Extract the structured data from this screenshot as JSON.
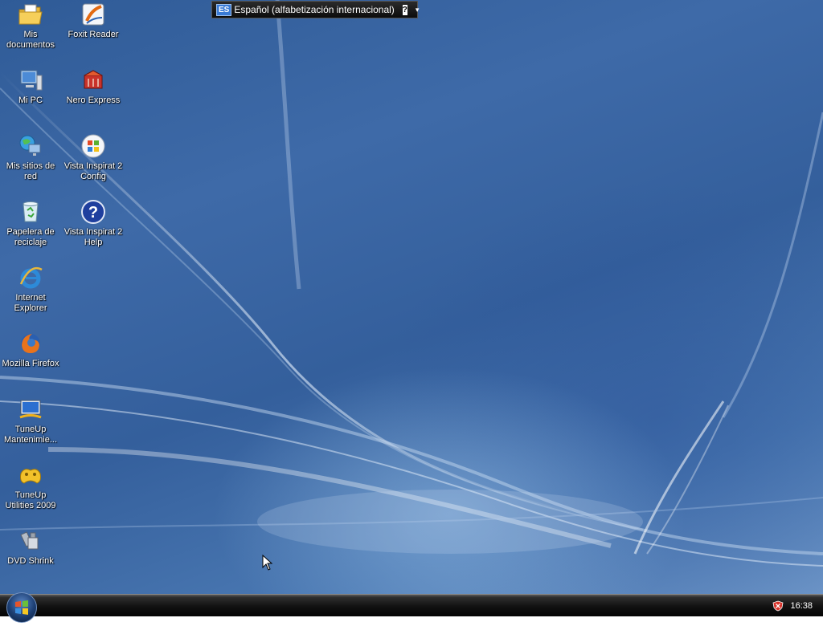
{
  "language_bar": {
    "code": "ES",
    "name": "Español (alfabetización internacional)",
    "help": "?",
    "options": "▾"
  },
  "desktop_icons": [
    {
      "id": "my-documents",
      "label": "Mis documentos",
      "icon": "folder-documents-icon"
    },
    {
      "id": "my-computer",
      "label": "Mi PC",
      "icon": "computer-icon"
    },
    {
      "id": "network-places",
      "label": "Mis sitios de red",
      "icon": "network-globe-icon"
    },
    {
      "id": "recycle-bin",
      "label": "Papelera de reciclaje",
      "icon": "recycle-bin-icon"
    },
    {
      "id": "internet-explorer",
      "label": "Internet Explorer",
      "icon": "internet-explorer-icon"
    },
    {
      "id": "mozilla-firefox",
      "label": "Mozilla Firefox",
      "icon": "firefox-icon"
    },
    {
      "id": "tuneup-maintenance",
      "label": "TuneUp Mantenimie...",
      "icon": "tuneup-monitor-icon"
    },
    {
      "id": "tuneup-utilities",
      "label": "TuneUp Utilities 2009",
      "icon": "tuneup-gamepad-icon"
    },
    {
      "id": "dvd-shrink",
      "label": "DVD Shrink",
      "icon": "dvd-shrink-icon"
    },
    {
      "id": "foxit-reader",
      "label": "Foxit Reader",
      "icon": "foxit-reader-icon"
    },
    {
      "id": "nero-express",
      "label": "Nero Express",
      "icon": "nero-express-icon"
    },
    {
      "id": "vista-inspirat-config",
      "label": "Vista Inspirat 2 Config",
      "icon": "windows-logo-icon"
    },
    {
      "id": "vista-inspirat-help",
      "label": "Vista Inspirat 2 Help",
      "icon": "help-question-icon"
    }
  ],
  "taskbar": {
    "clock": "16:38",
    "start_icon": "windows-orb-icon",
    "tray_icon": "security-alert-icon"
  }
}
